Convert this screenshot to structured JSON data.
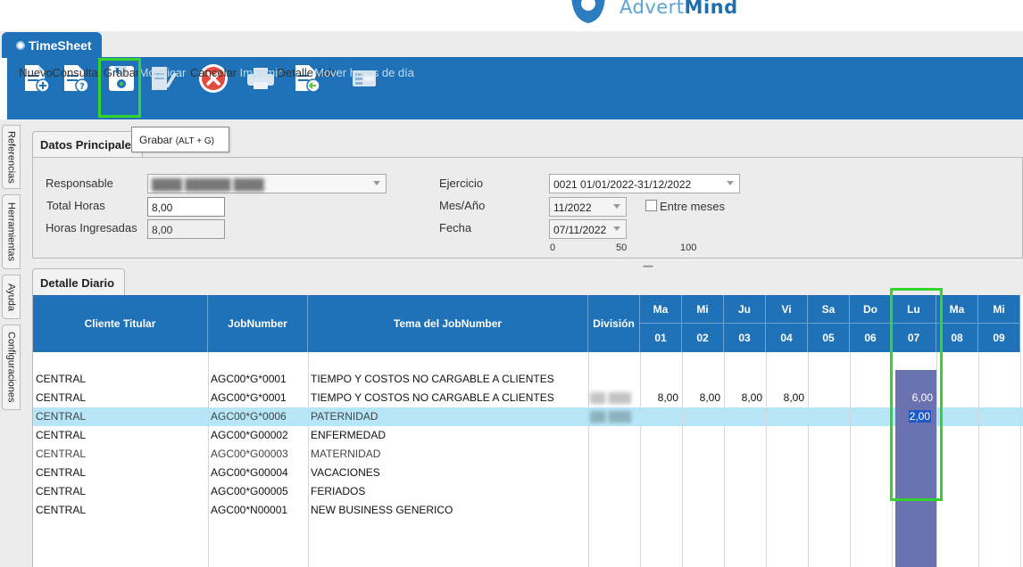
{
  "brand": {
    "prefix": "Advert",
    "suffix": "Mind"
  },
  "window_tab": {
    "label": "TimeSheet"
  },
  "toolbar": {
    "buttons": [
      {
        "id": "nuevo",
        "label": "Nuevo",
        "icon": "new-document-icon",
        "enabled": true
      },
      {
        "id": "consulta",
        "label": "Consulta",
        "icon": "query-document-icon",
        "enabled": true
      },
      {
        "id": "grabar",
        "label": "Grabar",
        "icon": "save-disk-icon",
        "enabled": true
      },
      {
        "id": "modificar",
        "label": "Modificar",
        "icon": "edit-document-icon",
        "enabled": false
      },
      {
        "id": "cancelar",
        "label": "Cancelar",
        "icon": "cancel-icon",
        "enabled": true
      },
      {
        "id": "imprimir",
        "label": "Imprimir",
        "icon": "printer-icon",
        "enabled": false
      },
      {
        "id": "detalle_job",
        "label": "Detalle Job",
        "icon": "job-detail-icon",
        "enabled": true
      },
      {
        "id": "mover_horas",
        "label": "Mover horas de día",
        "icon": "excel-move-icon",
        "enabled": false
      }
    ]
  },
  "tooltip": {
    "text": "Grabar",
    "shortcut": "(ALT + G)"
  },
  "side_tabs": [
    "Referencias",
    "Herramientas",
    "Ayuda",
    "Configuraciones"
  ],
  "datos_principales": {
    "title": "Datos Principales",
    "responsable_label": "Responsable",
    "responsable_value": "(blurred)",
    "total_horas_label": "Total Horas",
    "total_horas_value": "8,00",
    "horas_ingresadas_label": "Horas Ingresadas",
    "horas_ingresadas_value": "8,00",
    "ejercicio_label": "Ejercicio",
    "ejercicio_value": "0021 01/01/2022-31/12/2022",
    "mes_anio_label": "Mes/Año",
    "mes_anio_value": "11/2022",
    "entre_meses_label": "Entre meses",
    "entre_meses_checked": false,
    "fecha_label": "Fecha",
    "fecha_value": "07/11/2022",
    "scale": [
      "0",
      "50",
      "100"
    ]
  },
  "detalle_diario": {
    "title": "Detalle Diario",
    "columns": [
      "Cliente Titular",
      "JobNumber",
      "Tema del JobNumber",
      "División"
    ],
    "days": [
      {
        "name": "Ma",
        "num": "01"
      },
      {
        "name": "Mi",
        "num": "02"
      },
      {
        "name": "Ju",
        "num": "03"
      },
      {
        "name": "Vi",
        "num": "04"
      },
      {
        "name": "Sa",
        "num": "05"
      },
      {
        "name": "Do",
        "num": "06"
      },
      {
        "name": "Lu",
        "num": "07"
      },
      {
        "name": "Ma",
        "num": "08"
      },
      {
        "name": "Mi",
        "num": "09"
      }
    ],
    "rows": [
      {
        "cliente": "CENTRAL",
        "job": "AGC00*G*0001",
        "tema": "TIEMPO Y COSTOS NO CARGABLE A CLIENTES",
        "division": "",
        "hours": [
          "",
          "",
          "",
          "",
          "",
          "",
          "",
          "",
          ""
        ]
      },
      {
        "cliente": "CENTRAL",
        "job": "AGC00*G*0001",
        "tema": "TIEMPO Y COSTOS NO CARGABLE A CLIENTES",
        "division": "(blurred)",
        "hours": [
          "8,00",
          "8,00",
          "8,00",
          "8,00",
          "",
          "",
          "6,00",
          "",
          ""
        ]
      },
      {
        "cliente": "CENTRAL",
        "job": "AGC00*G*0006",
        "tema": "PATERNIDAD",
        "division": "(blurred)",
        "hours": [
          "",
          "",
          "",
          "",
          "",
          "",
          "2,00",
          "",
          ""
        ],
        "selected": true
      },
      {
        "cliente": "CENTRAL",
        "job": "AGC00*G00002",
        "tema": "ENFERMEDAD",
        "division": "",
        "hours": [
          "",
          "",
          "",
          "",
          "",
          "",
          "",
          "",
          ""
        ]
      },
      {
        "cliente": "CENTRAL",
        "job": "AGC00*G00003",
        "tema": "MATERNIDAD",
        "division": "",
        "hours": [
          "",
          "",
          "",
          "",
          "",
          "",
          "",
          "",
          ""
        ]
      },
      {
        "cliente": "CENTRAL",
        "job": "AGC00*G00004",
        "tema": "VACACIONES",
        "division": "",
        "hours": [
          "",
          "",
          "",
          "",
          "",
          "",
          "",
          "",
          ""
        ]
      },
      {
        "cliente": "CENTRAL",
        "job": "AGC00*G00005",
        "tema": "FERIADOS",
        "division": "",
        "hours": [
          "",
          "",
          "",
          "",
          "",
          "",
          "",
          "",
          ""
        ]
      },
      {
        "cliente": "CENTRAL",
        "job": "AGC00*N00001",
        "tema": "NEW BUSINESS GENERICO",
        "division": "",
        "hours": [
          "",
          "",
          "",
          "",
          "",
          "",
          "",
          "",
          ""
        ]
      }
    ]
  },
  "colors": {
    "accent": "#1f72b8",
    "highlight": "#35d42c",
    "selected_row": "#b6e6f7",
    "today_column": "#6b72b0"
  }
}
